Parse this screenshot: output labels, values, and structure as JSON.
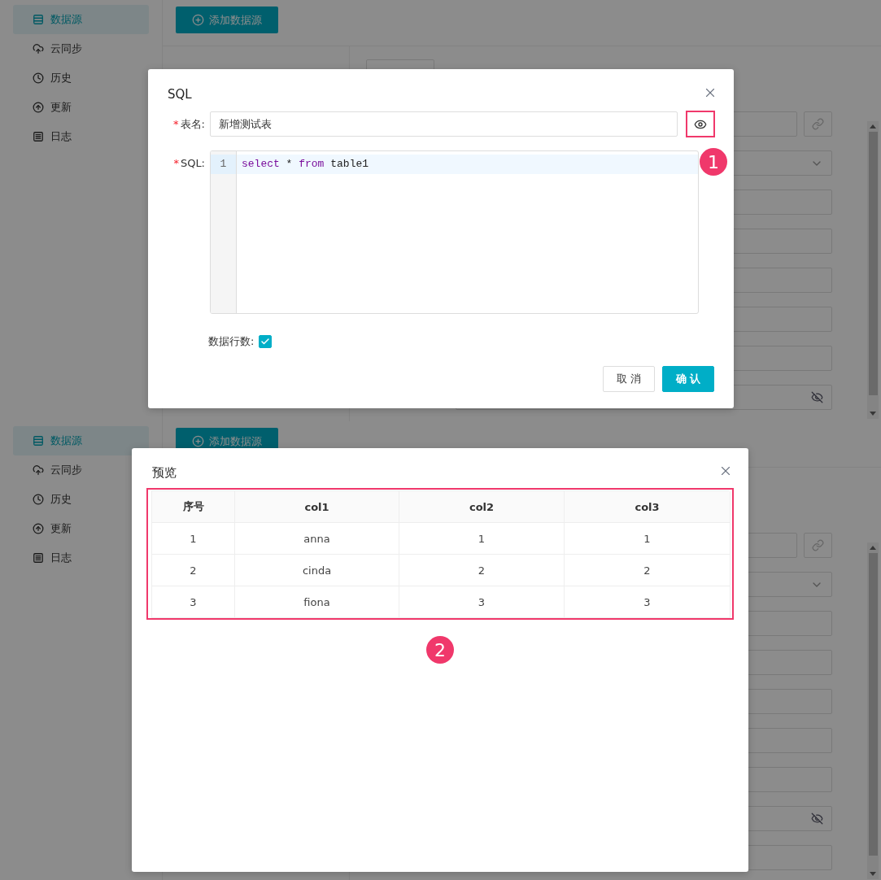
{
  "screens": [
    {
      "sidebar": [
        {
          "label": "数据源",
          "selected": true
        },
        {
          "label": "云同步",
          "selected": false
        },
        {
          "label": "历史",
          "selected": false
        },
        {
          "label": "更新",
          "selected": false
        },
        {
          "label": "日志",
          "selected": false
        }
      ],
      "add_button": "添加数据源",
      "small_button": true,
      "form_fields": [
        {
          "kind": "link"
        },
        {
          "kind": "select"
        },
        {
          "kind": "text"
        },
        {
          "kind": "text"
        },
        {
          "kind": "text"
        },
        {
          "kind": "text"
        },
        {
          "kind": "text"
        },
        {
          "kind": "password"
        }
      ],
      "dialog": {
        "kind": "sql",
        "title": "SQL",
        "name_field": {
          "mark": "*",
          "label": "表名:",
          "value": "新增测试表"
        },
        "sql_field": {
          "mark": "*",
          "label": "SQL:",
          "lines": [
            {
              "number": "1",
              "active": true,
              "tokens": [
                {
                  "text": "select",
                  "kind": "keyword"
                },
                {
                  "text": " * ",
                  "kind": "plain"
                },
                {
                  "text": "from",
                  "kind": "keyword"
                },
                {
                  "text": " table1",
                  "kind": "plain"
                }
              ]
            }
          ]
        },
        "row_count": {
          "label": "数据行数:",
          "checked": true
        },
        "buttons": [
          {
            "label": "取 消",
            "kind": "default"
          },
          {
            "label": "确 认",
            "kind": "primary"
          }
        ],
        "annotation": "1"
      }
    },
    {
      "sidebar": [
        {
          "label": "数据源",
          "selected": true
        },
        {
          "label": "云同步",
          "selected": false
        },
        {
          "label": "历史",
          "selected": false
        },
        {
          "label": "更新",
          "selected": false
        },
        {
          "label": "日志",
          "selected": false
        }
      ],
      "add_button": "添加数据源",
      "form_fields": [
        {
          "kind": "link"
        },
        {
          "kind": "select"
        },
        {
          "kind": "text"
        },
        {
          "kind": "text"
        },
        {
          "kind": "text"
        },
        {
          "kind": "text"
        },
        {
          "kind": "text"
        },
        {
          "kind": "password"
        },
        {
          "kind": "text"
        }
      ],
      "dialog": {
        "kind": "preview",
        "title": "预览",
        "table": {
          "columns": [
            "序号",
            "col1",
            "col2",
            "col3"
          ],
          "rows": [
            [
              "1",
              "anna",
              "1",
              "1"
            ],
            [
              "2",
              "cinda",
              "2",
              "2"
            ],
            [
              "3",
              "fiona",
              "3",
              "3"
            ]
          ]
        },
        "annotation": "2"
      }
    }
  ]
}
